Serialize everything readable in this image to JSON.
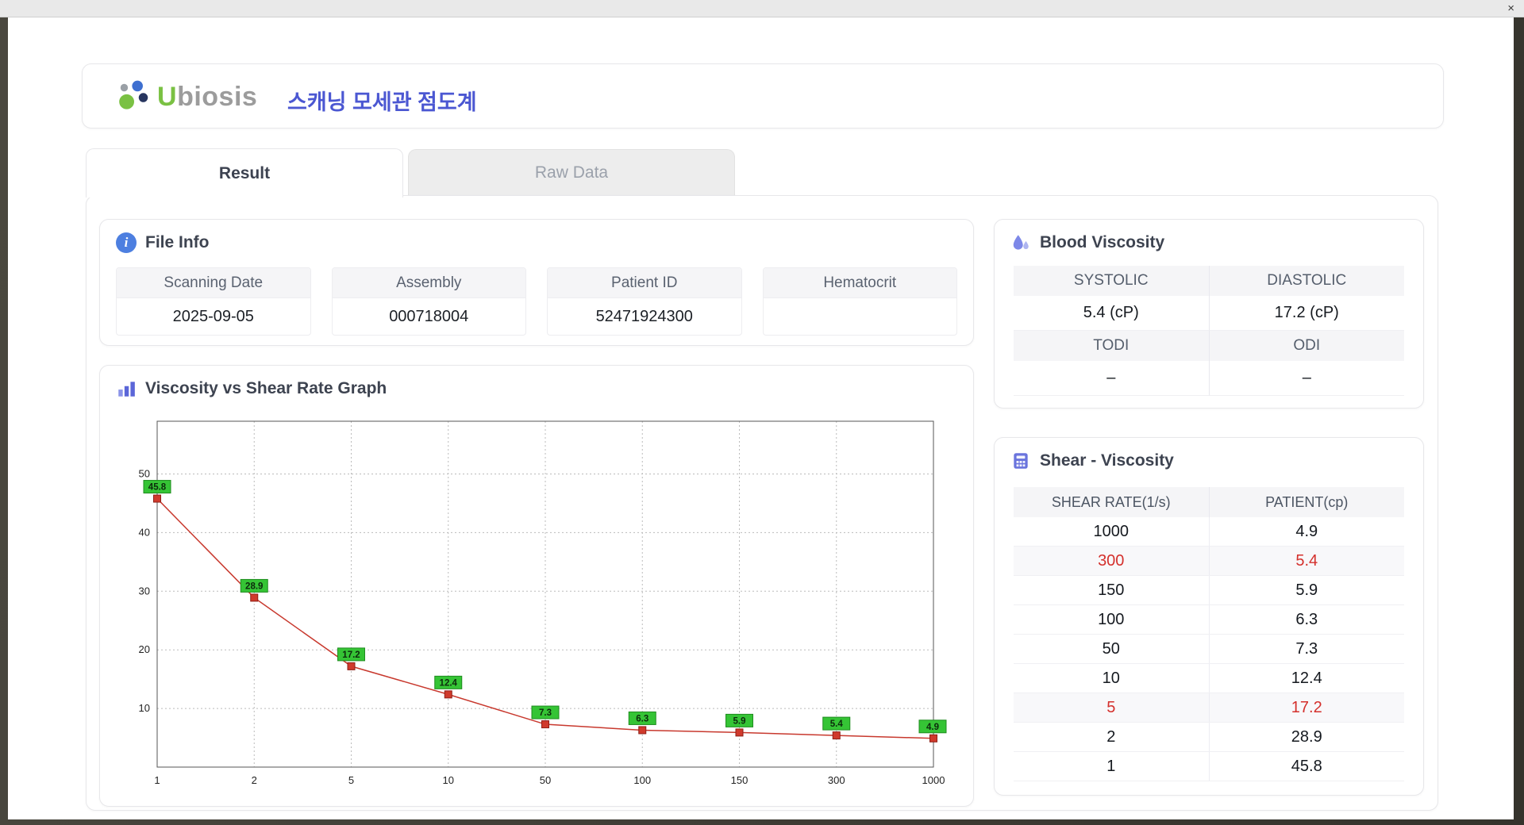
{
  "window": {
    "close": "×"
  },
  "header": {
    "logo": {
      "u": "U",
      "rest": "biosis"
    },
    "title": "스캐닝 모세관 점도계"
  },
  "tabs": [
    {
      "label": "Result",
      "active": true
    },
    {
      "label": "Raw Data",
      "active": false
    }
  ],
  "file_info": {
    "title": "File Info",
    "fields": [
      {
        "label": "Scanning Date",
        "value": "2025-09-05"
      },
      {
        "label": "Assembly",
        "value": "000718004"
      },
      {
        "label": "Patient ID",
        "value": "52471924300"
      },
      {
        "label": "Hematocrit",
        "value": ""
      }
    ]
  },
  "graph": {
    "title": "Viscosity vs Shear Rate Graph"
  },
  "blood_viscosity": {
    "title": "Blood Viscosity",
    "cells": [
      {
        "label": "SYSTOLIC",
        "value": "5.4 (cP)"
      },
      {
        "label": "DIASTOLIC",
        "value": "17.2 (cP)"
      },
      {
        "label": "TODI",
        "value": "–"
      },
      {
        "label": "ODI",
        "value": "–"
      }
    ]
  },
  "shear_viscosity": {
    "title": "Shear - Viscosity",
    "columns": [
      "SHEAR RATE(1/s)",
      "PATIENT(cp)"
    ],
    "rows": [
      {
        "shear": "1000",
        "patient": "4.9",
        "highlight": false
      },
      {
        "shear": "300",
        "patient": "5.4",
        "highlight": true
      },
      {
        "shear": "150",
        "patient": "5.9",
        "highlight": false
      },
      {
        "shear": "100",
        "patient": "6.3",
        "highlight": false
      },
      {
        "shear": "50",
        "patient": "7.3",
        "highlight": false
      },
      {
        "shear": "10",
        "patient": "12.4",
        "highlight": false
      },
      {
        "shear": "5",
        "patient": "17.2",
        "highlight": true
      },
      {
        "shear": "2",
        "patient": "28.9",
        "highlight": false
      },
      {
        "shear": "1",
        "patient": "45.8",
        "highlight": false
      }
    ]
  },
  "chart_data": {
    "type": "line",
    "title": "Viscosity vs Shear Rate Graph",
    "x_ticks": [
      "1",
      "2",
      "5",
      "10",
      "50",
      "100",
      "150",
      "300",
      "1000"
    ],
    "values": [
      45.8,
      28.9,
      17.2,
      12.4,
      7.3,
      6.3,
      5.9,
      5.4,
      4.9
    ],
    "y_ticks": [
      10,
      20,
      30,
      40,
      50
    ],
    "ylim": [
      0,
      59
    ],
    "x_spacing": "equal",
    "grid": true,
    "legend": "none",
    "line_color": "#c8392e",
    "marker": "square",
    "marker_color": "#d03a2c",
    "marker_border": "#8e1f16",
    "label_bg": "#35c435",
    "label_border": "#1f8c1f",
    "label_text_color": "#0c2a0c"
  },
  "colors": {
    "accent_blue": "#4b57d2",
    "logo_green": "#7ac143",
    "icon_indigo": "#6a74dd",
    "info_blue": "#4d7fe0",
    "red_highlight": "#d4302c"
  }
}
